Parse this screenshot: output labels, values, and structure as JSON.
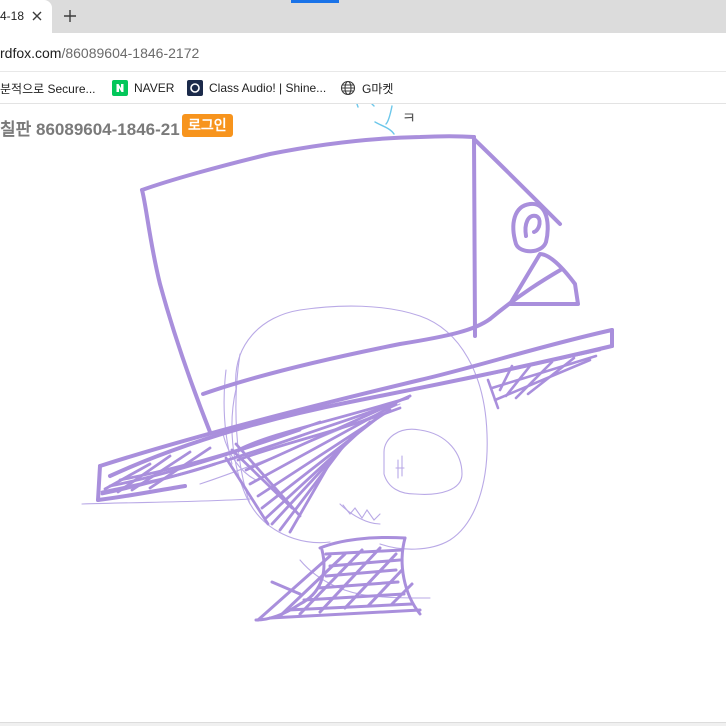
{
  "tab": {
    "title": "4-18",
    "close_icon": "close-icon",
    "new_tab_icon": "plus-icon"
  },
  "address": {
    "domain": "rdfox.com",
    "path": "/86089604-1846-2172"
  },
  "bookmarks": [
    {
      "label": "분적으로 Secure...",
      "icon": "none"
    },
    {
      "label": "NAVER",
      "icon": "naver-icon",
      "color": "#03c75a"
    },
    {
      "label": "Class Audio! | Shine...",
      "icon": "class-audio-icon",
      "color": "#1b2a4a"
    },
    {
      "label": "G마켓",
      "icon": "globe-icon"
    }
  ],
  "page": {
    "title": "칠판 86089604-1846-21",
    "login_label": "로그인",
    "login_color": "#f7941d",
    "doodle_text": "ㅋ",
    "stroke_color": "#a98fdc",
    "thin_stroke_color": "#b9a9e6",
    "blue_stroke_color": "#6cc7ea"
  }
}
